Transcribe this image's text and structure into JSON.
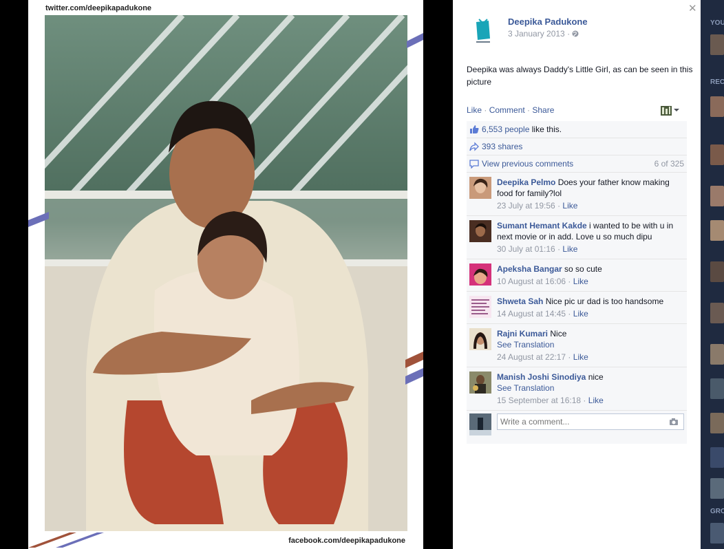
{
  "photo": {
    "watermark_top": "twitter.com/deepikapadukone",
    "watermark_bottom": "facebook.com/deepikapadukone"
  },
  "post": {
    "page_name": "Deepika Padukone",
    "date": "3 January 2013",
    "date_separator": "·",
    "privacy_icon": "globe-icon",
    "text": "Deepika was always Daddy's Little Girl, as can be seen in this picture",
    "actions": {
      "like": "Like",
      "comment": "Comment",
      "share": "Share",
      "sep": " · "
    },
    "likes": {
      "count": "6,553 people",
      "suffix": " like this."
    },
    "shares": "393 shares",
    "view_previous": "View previous comments",
    "pager": "6 of 325",
    "comments": [
      {
        "name": "Deepika Pelmo",
        "text": "Does your father know making food for family?lol",
        "translation": "",
        "time": "23 July at 19:56",
        "like": "Like"
      },
      {
        "name": "Sumant Hemant Kakde",
        "text": "i wanted to be with u in next movie or in add. Love u so much dipu",
        "translation": "",
        "time": "30 July at 01:16",
        "like": "Like"
      },
      {
        "name": "Apeksha Bangar",
        "text": "so so cute",
        "translation": "",
        "time": "10 August at 16:06",
        "like": "Like"
      },
      {
        "name": "Shweta Sah",
        "text": "Nice pic ur dad is too handsome",
        "translation": "",
        "time": "14 August at 14:45",
        "like": "Like"
      },
      {
        "name": "Rajni Kumari",
        "text": "Nice",
        "translation": "See Translation",
        "time": "24 August at 22:17",
        "like": "Like"
      },
      {
        "name": "Manish Joshi Sinodiya",
        "text": "nice",
        "translation": "See Translation",
        "time": "15 September at 16:18",
        "like": "Like"
      }
    ],
    "write_placeholder": "Write a comment..."
  },
  "rail": {
    "labels": [
      "YOU",
      "REC",
      "GRO"
    ]
  },
  "colors": {
    "link": "#3b5998",
    "meta": "#9197a3",
    "ufi_bg": "#f6f7f9"
  }
}
